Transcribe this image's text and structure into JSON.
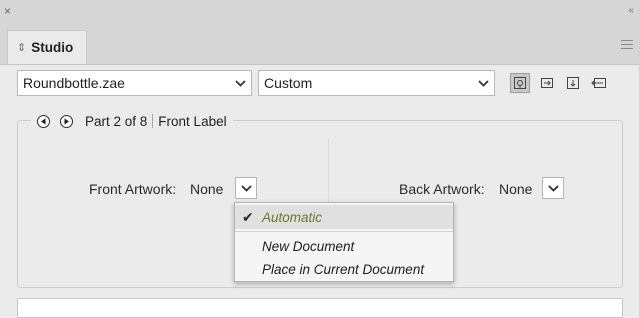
{
  "window": {
    "close_glyph": "×",
    "collapse_glyph": "‹‹"
  },
  "tab": {
    "label": "Studio",
    "icon": "sort-arrows-icon"
  },
  "model_select": {
    "value": "Roundbottle.zae"
  },
  "view_select": {
    "value": "Custom"
  },
  "view_icons": [
    "product-view-icon",
    "side-view-icon",
    "top-view-icon",
    "back-view-icon"
  ],
  "part_nav": {
    "text": "Part 2 of 8",
    "label": "Front Label"
  },
  "front": {
    "label": "Front Artwork:",
    "value": "None"
  },
  "back": {
    "label": "Back Artwork:",
    "value": "None"
  },
  "dropdown_menu": {
    "items": [
      {
        "label": "Automatic",
        "checked": true
      },
      {
        "label": "New Document",
        "checked": false
      },
      {
        "label": "Place in Current Document",
        "checked": false
      }
    ]
  },
  "colors": {
    "accent_check_text": "#6b7a2a",
    "panel_bg": "#ebebeb",
    "chrome_bg": "#d6d6d6"
  }
}
